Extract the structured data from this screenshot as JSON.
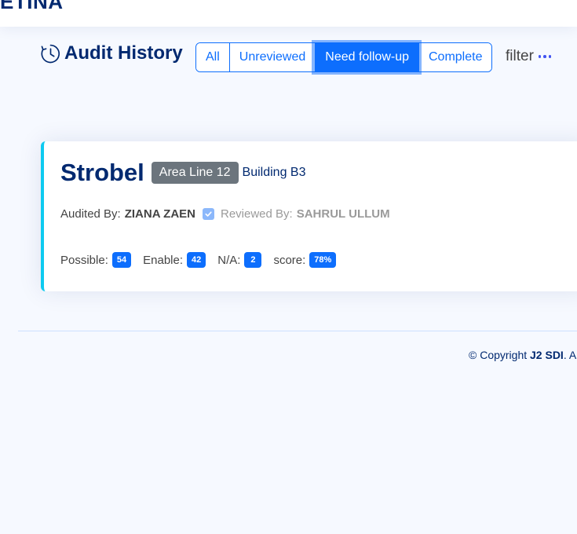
{
  "app": {
    "logo_text": "ETINA"
  },
  "page": {
    "title": "Audit History",
    "title_icon": "clock-icon"
  },
  "filters": {
    "tabs": [
      {
        "label": "All",
        "active": false
      },
      {
        "label": "Unreviewed",
        "active": false
      },
      {
        "label": "Need follow-up",
        "active": true
      },
      {
        "label": "Complete",
        "active": false
      }
    ],
    "filter_label": "filter",
    "more_icon": "three-dots-icon"
  },
  "audit_card": {
    "title": "Strobel",
    "area_badge": "Area Line 12",
    "building": "Building B3",
    "audited_by_label": "Audited By:",
    "audited_by_name": "ZIANA ZAEN",
    "reviewed_icon": "check-square-icon",
    "reviewed_by_label": "Reviewed By:",
    "reviewed_by_name": "SAHRUL ULLUM",
    "stats": [
      {
        "label": "Possible:",
        "value": "54"
      },
      {
        "label": "Enable:",
        "value": "42"
      },
      {
        "label": "N/A:",
        "value": "2"
      },
      {
        "label": "score:",
        "value": "78%"
      }
    ]
  },
  "footer": {
    "copyright_prefix": "© Copyright",
    "company": "J2 SDI",
    "suffix": ". A"
  },
  "colors": {
    "primary": "#0d6efd",
    "navy": "#012970",
    "card_accent": "#0dcaf0",
    "badge_gray": "#6c757d",
    "page_bg": "#f6f9ff"
  }
}
